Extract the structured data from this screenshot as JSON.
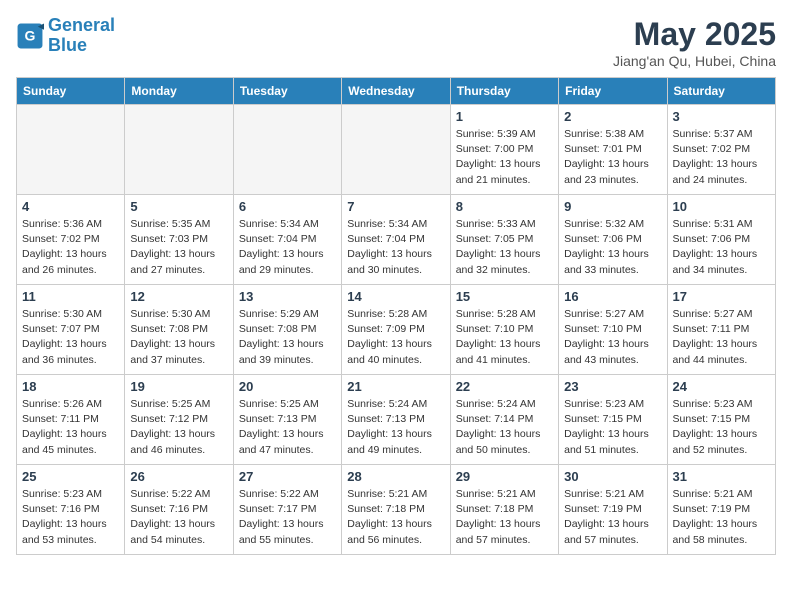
{
  "logo": {
    "line1": "General",
    "line2": "Blue"
  },
  "title": "May 2025",
  "location": "Jiang'an Qu, Hubei, China",
  "days_of_week": [
    "Sunday",
    "Monday",
    "Tuesday",
    "Wednesday",
    "Thursday",
    "Friday",
    "Saturday"
  ],
  "weeks": [
    [
      {
        "day": "",
        "info": ""
      },
      {
        "day": "",
        "info": ""
      },
      {
        "day": "",
        "info": ""
      },
      {
        "day": "",
        "info": ""
      },
      {
        "day": "1",
        "info": "Sunrise: 5:39 AM\nSunset: 7:00 PM\nDaylight: 13 hours\nand 21 minutes."
      },
      {
        "day": "2",
        "info": "Sunrise: 5:38 AM\nSunset: 7:01 PM\nDaylight: 13 hours\nand 23 minutes."
      },
      {
        "day": "3",
        "info": "Sunrise: 5:37 AM\nSunset: 7:02 PM\nDaylight: 13 hours\nand 24 minutes."
      }
    ],
    [
      {
        "day": "4",
        "info": "Sunrise: 5:36 AM\nSunset: 7:02 PM\nDaylight: 13 hours\nand 26 minutes."
      },
      {
        "day": "5",
        "info": "Sunrise: 5:35 AM\nSunset: 7:03 PM\nDaylight: 13 hours\nand 27 minutes."
      },
      {
        "day": "6",
        "info": "Sunrise: 5:34 AM\nSunset: 7:04 PM\nDaylight: 13 hours\nand 29 minutes."
      },
      {
        "day": "7",
        "info": "Sunrise: 5:34 AM\nSunset: 7:04 PM\nDaylight: 13 hours\nand 30 minutes."
      },
      {
        "day": "8",
        "info": "Sunrise: 5:33 AM\nSunset: 7:05 PM\nDaylight: 13 hours\nand 32 minutes."
      },
      {
        "day": "9",
        "info": "Sunrise: 5:32 AM\nSunset: 7:06 PM\nDaylight: 13 hours\nand 33 minutes."
      },
      {
        "day": "10",
        "info": "Sunrise: 5:31 AM\nSunset: 7:06 PM\nDaylight: 13 hours\nand 34 minutes."
      }
    ],
    [
      {
        "day": "11",
        "info": "Sunrise: 5:30 AM\nSunset: 7:07 PM\nDaylight: 13 hours\nand 36 minutes."
      },
      {
        "day": "12",
        "info": "Sunrise: 5:30 AM\nSunset: 7:08 PM\nDaylight: 13 hours\nand 37 minutes."
      },
      {
        "day": "13",
        "info": "Sunrise: 5:29 AM\nSunset: 7:08 PM\nDaylight: 13 hours\nand 39 minutes."
      },
      {
        "day": "14",
        "info": "Sunrise: 5:28 AM\nSunset: 7:09 PM\nDaylight: 13 hours\nand 40 minutes."
      },
      {
        "day": "15",
        "info": "Sunrise: 5:28 AM\nSunset: 7:10 PM\nDaylight: 13 hours\nand 41 minutes."
      },
      {
        "day": "16",
        "info": "Sunrise: 5:27 AM\nSunset: 7:10 PM\nDaylight: 13 hours\nand 43 minutes."
      },
      {
        "day": "17",
        "info": "Sunrise: 5:27 AM\nSunset: 7:11 PM\nDaylight: 13 hours\nand 44 minutes."
      }
    ],
    [
      {
        "day": "18",
        "info": "Sunrise: 5:26 AM\nSunset: 7:11 PM\nDaylight: 13 hours\nand 45 minutes."
      },
      {
        "day": "19",
        "info": "Sunrise: 5:25 AM\nSunset: 7:12 PM\nDaylight: 13 hours\nand 46 minutes."
      },
      {
        "day": "20",
        "info": "Sunrise: 5:25 AM\nSunset: 7:13 PM\nDaylight: 13 hours\nand 47 minutes."
      },
      {
        "day": "21",
        "info": "Sunrise: 5:24 AM\nSunset: 7:13 PM\nDaylight: 13 hours\nand 49 minutes."
      },
      {
        "day": "22",
        "info": "Sunrise: 5:24 AM\nSunset: 7:14 PM\nDaylight: 13 hours\nand 50 minutes."
      },
      {
        "day": "23",
        "info": "Sunrise: 5:23 AM\nSunset: 7:15 PM\nDaylight: 13 hours\nand 51 minutes."
      },
      {
        "day": "24",
        "info": "Sunrise: 5:23 AM\nSunset: 7:15 PM\nDaylight: 13 hours\nand 52 minutes."
      }
    ],
    [
      {
        "day": "25",
        "info": "Sunrise: 5:23 AM\nSunset: 7:16 PM\nDaylight: 13 hours\nand 53 minutes."
      },
      {
        "day": "26",
        "info": "Sunrise: 5:22 AM\nSunset: 7:16 PM\nDaylight: 13 hours\nand 54 minutes."
      },
      {
        "day": "27",
        "info": "Sunrise: 5:22 AM\nSunset: 7:17 PM\nDaylight: 13 hours\nand 55 minutes."
      },
      {
        "day": "28",
        "info": "Sunrise: 5:21 AM\nSunset: 7:18 PM\nDaylight: 13 hours\nand 56 minutes."
      },
      {
        "day": "29",
        "info": "Sunrise: 5:21 AM\nSunset: 7:18 PM\nDaylight: 13 hours\nand 57 minutes."
      },
      {
        "day": "30",
        "info": "Sunrise: 5:21 AM\nSunset: 7:19 PM\nDaylight: 13 hours\nand 57 minutes."
      },
      {
        "day": "31",
        "info": "Sunrise: 5:21 AM\nSunset: 7:19 PM\nDaylight: 13 hours\nand 58 minutes."
      }
    ]
  ]
}
